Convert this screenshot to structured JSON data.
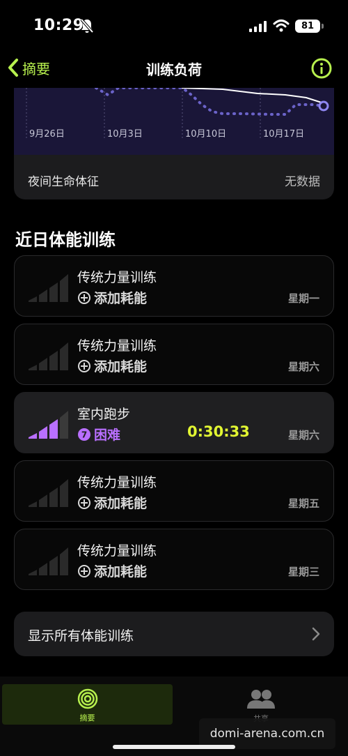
{
  "status_bar": {
    "time": "10:29",
    "battery": "81"
  },
  "nav": {
    "back_label": "摘要",
    "title": "训练负荷"
  },
  "chart": {
    "x_labels": [
      "9月26日",
      "10月3日",
      "10月10日",
      "10月17日"
    ]
  },
  "vitals": {
    "label": "夜间生命体征",
    "value": "无数据"
  },
  "section_title": "近日体能训练",
  "workouts": [
    {
      "name": "传统力量训练",
      "sub": "添加耗能",
      "day": "星期一",
      "active": false
    },
    {
      "name": "传统力量训练",
      "sub": "添加耗能",
      "day": "星期六",
      "active": false
    },
    {
      "name": "室内跑步",
      "sub": "困难",
      "effort_badge": "7",
      "duration": "0:30:33",
      "day": "星期六",
      "active": true
    },
    {
      "name": "传统力量训练",
      "sub": "添加耗能",
      "day": "星期五",
      "active": false
    },
    {
      "name": "传统力量训练",
      "sub": "添加耗能",
      "day": "星期三",
      "active": false
    }
  ],
  "show_all_label": "显示所有体能训练",
  "tabs": {
    "summary": "摘要",
    "sharing": "共享"
  },
  "watermark": "domi-arena.com.cn",
  "colors": {
    "accent_green": "#b7f04e",
    "effort_purple": "#b96fff",
    "duration_yellow": "#e1f532"
  }
}
